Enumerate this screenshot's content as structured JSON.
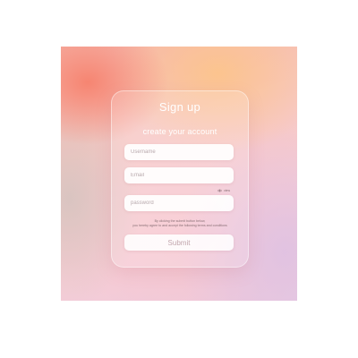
{
  "form": {
    "title": "Sign up",
    "subtitle": "create your account",
    "username_placeholder": "Username",
    "email_placeholder": "Email",
    "password_placeholder": "password",
    "show_password_label": "view",
    "terms_line_1": "By clicking the submit button below,",
    "terms_line_2": "you hereby agree to and accept the following terms and conditions",
    "submit_label": "Submit"
  },
  "theme": {
    "text_color": "#ffffff",
    "field_background": "#ffffff",
    "submit_text_color": "#c2a6ad",
    "gradient_colors": [
      "#f6826e",
      "#fcc48c",
      "#f7c4ce",
      "#e0c2e2"
    ]
  },
  "icons": {
    "show_password": "eye-icon"
  }
}
